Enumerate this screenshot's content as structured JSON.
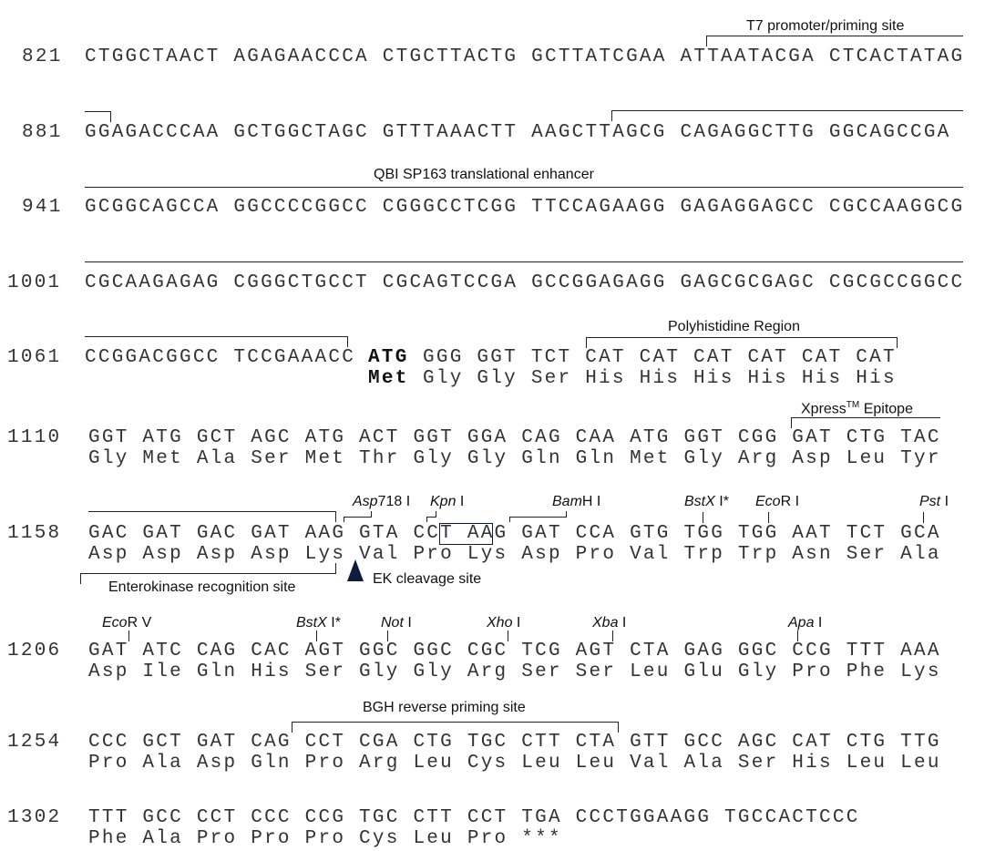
{
  "rows": [
    {
      "pos": "821",
      "dna": "CTGGCTAACT AGAGAACCCA CTGCTTACTG GCTTATCGAA ATTAATACGA CTCACTATAG"
    },
    {
      "pos": "881",
      "dna": "GGAGACCCAA GCTGGCTAGC GTTTAAACTT AAGCTTAGCG CAGAGGCTTG GGCAGCCGA"
    },
    {
      "pos": "941",
      "dna": "GCGGCAGCCA GGCCCCGGCC CGGGCCTCGG TTCCAGAAGG GAGAGGAGCC CGCCAAGGCG"
    },
    {
      "pos": "1001",
      "dna": "CGCAAGAGAG CGGGCTGCCT CGCAGTCCGA GCCGGAGAGG GAGCGCGAGC CGCGCCGGCC"
    },
    {
      "pos": "1061",
      "dna_pre": "CCGGACGGCC TCCGAAACC",
      "start_codon": "ATG",
      "start_aa": "Met",
      "dna": "GGG GGT TCT CAT CAT CAT CAT CAT CAT",
      "aa": "Gly Gly Ser His His His His His His"
    },
    {
      "pos": "1110",
      "dna": "GGT ATG GCT AGC ATG ACT GGT GGA CAG CAA ATG GGT CGG GAT CTG TAC",
      "aa": "Gly Met Ala Ser Met Thr Gly Gly Gln Gln Met Gly Arg Asp Leu Tyr"
    },
    {
      "pos": "1158",
      "dna": "GAC GAT GAC GAT AAG GTA CCT AAG GAT CCA GTG TGG TGG AAT TCT GCA",
      "aa": "Asp Asp Asp Asp Lys Val Pro Lys Asp Pro Val Trp Trp Asn Ser Ala"
    },
    {
      "pos": "1206",
      "dna": "GAT ATC CAG CAC AGT GGC GGC CGC TCG AGT CTA GAG GGC CCG TTT AAA",
      "aa": "Asp Ile Gln His Ser Gly Gly Arg Ser Ser Leu Glu Gly Pro Phe Lys"
    },
    {
      "pos": "1254",
      "dna": "CCC GCT GAT CAG CCT CGA CTG TGC CTT CTA GTT GCC AGC CAT CTG TTG",
      "aa": "Pro Ala Asp Gln Pro Arg Leu Cys Leu Leu Val Ala Ser His Leu Leu"
    },
    {
      "pos": "1302",
      "dna": "TTT GCC CCT CCC CCG TGC CTT CCT TGA CCCTGGAAGG TGCCACTCCC",
      "aa": "Phe Ala Pro Pro Pro Cys Leu Pro ***"
    }
  ],
  "features": {
    "t7": "T7 promoter/priming site",
    "qbi": "QBI SP163 translational enhancer",
    "polyhis": "Polyhistidine Region",
    "xpress_name": "Xpress",
    "xpress_tm": "TM",
    "xpress_suffix": " Epitope",
    "ek_site": "Enterokinase recognition site",
    "ek_cleavage": "EK cleavage site",
    "bgh": "BGH reverse priming site"
  },
  "enzymes": {
    "asp718": {
      "italic": "Asp",
      "rest": "718 I"
    },
    "kpn": {
      "italic": "Kpn",
      "rest": " I"
    },
    "bamh": {
      "italic": "Bam",
      "rest": "H I"
    },
    "bstx1": {
      "italic": "BstX",
      "rest": " I*"
    },
    "ecori": {
      "italic": "Eco",
      "rest": "R I"
    },
    "pst": {
      "italic": "Pst",
      "rest": " I"
    },
    "ecorv": {
      "italic": "Eco",
      "rest": "R V"
    },
    "bstx2": {
      "italic": "BstX",
      "rest": " I*"
    },
    "not": {
      "italic": "Not",
      "rest": " I"
    },
    "xho": {
      "italic": "Xho",
      "rest": " I"
    },
    "xba": {
      "italic": "Xba",
      "rest": " I"
    },
    "apa": {
      "italic": "Apa",
      "rest": " I"
    }
  }
}
